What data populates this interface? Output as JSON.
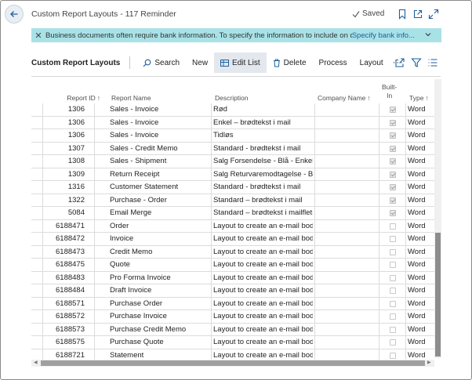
{
  "window": {
    "title": "Custom Report Layouts - 117 Reminder",
    "saved_label": "Saved"
  },
  "banner": {
    "message": "Business documents often require bank information. To specify the information to include on d...",
    "link": "Specify bank info..."
  },
  "actions": {
    "page_name": "Custom Report Layouts",
    "search": "Search",
    "new": "New",
    "edit_list": "Edit List",
    "delete": "Delete",
    "process": "Process",
    "layout": "Layout"
  },
  "columns": {
    "report_id": "Report ID",
    "report_name": "Report Name",
    "description": "Description",
    "company_name": "Company Name",
    "built_in_1": "Built-",
    "built_in_2": "In",
    "type": "Type"
  },
  "rows": [
    {
      "id": "1306",
      "name": "Sales - Invoice",
      "desc": "Rød",
      "builtin": true,
      "type": "Word"
    },
    {
      "id": "1306",
      "name": "Sales - Invoice",
      "desc": "Enkel – brødtekst i mail",
      "builtin": true,
      "type": "Word"
    },
    {
      "id": "1306",
      "name": "Sales - Invoice",
      "desc": "Tidløs",
      "builtin": true,
      "type": "Word"
    },
    {
      "id": "1307",
      "name": "Sales - Credit Memo",
      "desc": "Standard - brødtekst i mail",
      "builtin": true,
      "type": "Word"
    },
    {
      "id": "1308",
      "name": "Sales - Shipment",
      "desc": "Salg Forsendelse - Blå - Enkel",
      "builtin": true,
      "type": "Word"
    },
    {
      "id": "1309",
      "name": "Return Receipt",
      "desc": "Salg Returvaremodtagelse - Blå...",
      "builtin": true,
      "type": "Word"
    },
    {
      "id": "1316",
      "name": "Customer Statement",
      "desc": "Standard - brødtekst i mail",
      "builtin": true,
      "type": "Word"
    },
    {
      "id": "1322",
      "name": "Purchase - Order",
      "desc": "Standard – brødtekst i mail",
      "builtin": true,
      "type": "Word"
    },
    {
      "id": "5084",
      "name": "Email Merge",
      "desc": "Standard – brødtekst i mailfletn...",
      "builtin": true,
      "type": "Word"
    },
    {
      "id": "6188471",
      "name": "Order",
      "desc": "Layout to create an e-mail body",
      "builtin": false,
      "type": "Word"
    },
    {
      "id": "6188472",
      "name": "Invoice",
      "desc": "Layout to create an e-mail body",
      "builtin": false,
      "type": "Word"
    },
    {
      "id": "6188473",
      "name": "Credit Memo",
      "desc": "Layout to create an e-mail body",
      "builtin": false,
      "type": "Word"
    },
    {
      "id": "6188475",
      "name": "Quote",
      "desc": "Layout to create an e-mail body",
      "builtin": false,
      "type": "Word"
    },
    {
      "id": "6188483",
      "name": "Pro Forma Invoice",
      "desc": "Layout to create an e-mail body",
      "builtin": false,
      "type": "Word"
    },
    {
      "id": "6188484",
      "name": "Draft Invoice",
      "desc": "Layout to create an e-mail body",
      "builtin": false,
      "type": "Word"
    },
    {
      "id": "6188571",
      "name": "Purchase Order",
      "desc": "Layout to create an e-mail body",
      "builtin": false,
      "type": "Word"
    },
    {
      "id": "6188572",
      "name": "Purchase Invoice",
      "desc": "Layout to create an e-mail body",
      "builtin": false,
      "type": "Word"
    },
    {
      "id": "6188573",
      "name": "Purchase Credit Memo",
      "desc": "Layout to create an e-mail body",
      "builtin": false,
      "type": "Word"
    },
    {
      "id": "6188575",
      "name": "Purchase Quote",
      "desc": "Layout to create an e-mail body",
      "builtin": false,
      "type": "Word"
    },
    {
      "id": "6188721",
      "name": "Statement",
      "desc": "Layout to create an e-mail body",
      "builtin": false,
      "type": "Word"
    }
  ],
  "icons": {
    "back": "back-arrow-icon",
    "saved": "checkmark-icon",
    "bookmark": "bookmark-icon",
    "open_new": "open-in-new-window-icon",
    "expand": "expand-icon",
    "banner_close": "close-icon",
    "banner_chevron": "chevron-down-icon",
    "search": "search-icon",
    "edit_list": "edit-list-icon",
    "delete": "trash-icon",
    "more": "more-options-icon",
    "share": "share-icon",
    "filter": "filter-icon",
    "list_view": "list-view-icon"
  },
  "colors": {
    "banner_bg": "#a8e2e7",
    "link": "#1c5f9e",
    "accent": "#1c5f9e"
  }
}
